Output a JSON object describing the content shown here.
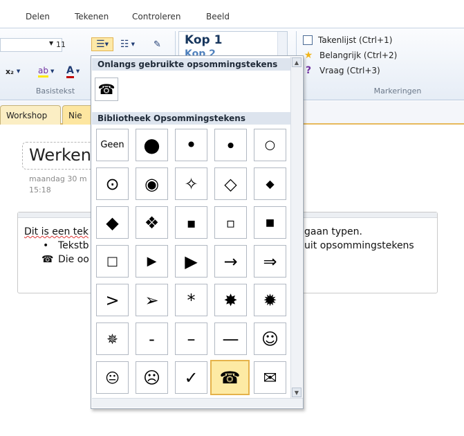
{
  "ribbon_tabs": [
    "Delen",
    "Tekenen",
    "Controleren",
    "Beeld"
  ],
  "ribbon": {
    "font_size": "11",
    "style_kop1": "Kop 1",
    "style_kop2": "Kop 2",
    "group_basistekst": "Basistekst",
    "group_markeringen": "Markeringen",
    "tags": [
      {
        "label": "Takenlijst (Ctrl+1)",
        "icon": "checkbox-icon"
      },
      {
        "label": "Belangrijk (Ctrl+2)",
        "icon": "star-icon"
      },
      {
        "label": "Vraag (Ctrl+3)",
        "icon": "question-icon"
      }
    ]
  },
  "section_tabs": [
    "Workshop",
    "Nie"
  ],
  "page": {
    "title": "Werken",
    "date": "maandag 30 m",
    "time": "15:18",
    "outline_lines": [
      {
        "bullet": "",
        "text": "Dit is een tek"
      },
      {
        "bullet": "•",
        "text": "Tekstb"
      },
      {
        "bullet": "☎",
        "text": "Die oo"
      }
    ],
    "outline_right_lines": [
      "gaan typen.",
      "uit opsommingstekens"
    ]
  },
  "dropdown": {
    "recent_header": "Onlangs gebruikte opsommingstekens",
    "recent": [
      "☎"
    ],
    "library_header": "Bibliotheek Opsommingstekens",
    "library": [
      [
        "Geen",
        "●",
        "•",
        "∙",
        "○"
      ],
      [
        "⊙",
        "◉",
        "✧",
        "◇",
        "◆"
      ],
      [
        "◆",
        "❖",
        "▪",
        "▫",
        "■"
      ],
      [
        "□",
        "▶",
        "▶",
        "→",
        "⇒"
      ],
      [
        ">",
        "➢",
        "*",
        "✸",
        "✹"
      ],
      [
        "✵",
        "-",
        "–",
        "—",
        "☺"
      ],
      [
        "😐",
        "☹",
        "✓",
        "☎",
        "✉"
      ]
    ],
    "selected_label": "☎"
  }
}
